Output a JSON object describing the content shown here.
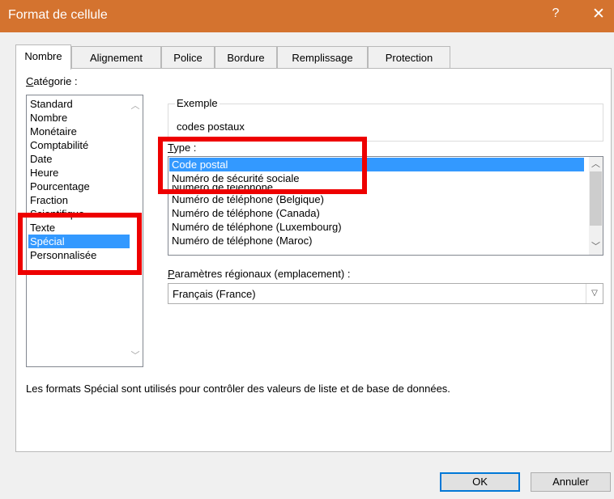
{
  "window": {
    "title": "Format de cellule",
    "help_label": "?",
    "close_label": "✕"
  },
  "tabs": [
    {
      "label": "Nombre",
      "active": true
    },
    {
      "label": "Alignement",
      "active": false
    },
    {
      "label": "Police",
      "active": false
    },
    {
      "label": "Bordure",
      "active": false
    },
    {
      "label": "Remplissage",
      "active": false
    },
    {
      "label": "Protection",
      "active": false
    }
  ],
  "category": {
    "label_prefix": "",
    "label_mnemonic": "C",
    "label_rest": "atégorie :",
    "items": [
      "Standard",
      "Nombre",
      "Monétaire",
      "Comptabilité",
      "Date",
      "Heure",
      "Pourcentage",
      "Fraction",
      "Scientifique",
      "Texte",
      "Spécial",
      "Personnalisée"
    ],
    "selected": "Spécial"
  },
  "example": {
    "legend": "Exemple",
    "value": "codes postaux"
  },
  "type": {
    "label_mnemonic": "T",
    "label_rest": "ype :",
    "partial_item": "Numéro de téléphone",
    "items": [
      "Code postal",
      "Numéro de sécurité sociale",
      "Numéro de téléphone",
      "Numéro de téléphone (Belgique)",
      "Numéro de téléphone (Canada)",
      "Numéro de téléphone (Luxembourg)",
      "Numéro de téléphone (Maroc)"
    ],
    "selected": "Code postal"
  },
  "locale": {
    "label_prefix": "",
    "label_mnemonic": "P",
    "label_rest": "aramètres régionaux (emplacement) :",
    "value": "Français (France)"
  },
  "description": "Les formats Spécial sont utilisés pour contrôler des valeurs de liste et de base de données.",
  "buttons": {
    "ok": "OK",
    "cancel": "Annuler"
  },
  "colors": {
    "titlebar": "#d4732f",
    "selection": "#3399ff",
    "highlight_box": "#ee0000"
  },
  "icons": {
    "scroll_up": "chevron-up-icon",
    "scroll_down": "chevron-down-icon",
    "dropdown": "chevron-down-icon"
  }
}
